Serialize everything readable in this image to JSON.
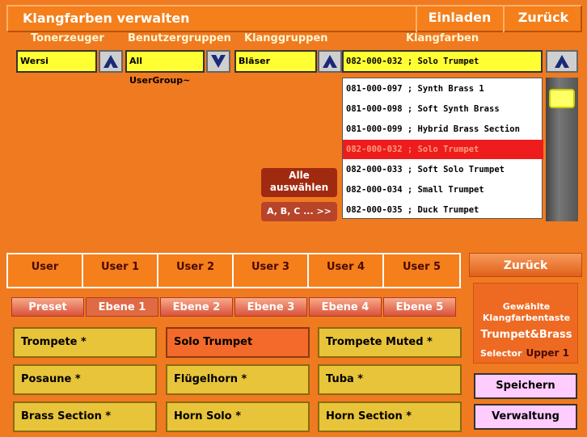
{
  "header": {
    "title": "Klangfarben verwalten",
    "load_label": "Einladen",
    "back_label": "Zurück"
  },
  "columns": {
    "tone_generator": "Tonerzeuger",
    "user_groups": "Benutzergruppen",
    "sound_groups": "Klanggruppen",
    "sounds": "Klangfarben"
  },
  "selectors": {
    "tone_generator": "Wersi",
    "user_group": "All UserGroup~",
    "sound_group": "Bläser",
    "sound": "082-000-032 ; Solo Trumpet"
  },
  "sound_list": [
    "081-000-097 ; Synth Brass 1",
    "081-000-098 ; Soft Synth Brass",
    "081-000-099 ; Hybrid Brass Section",
    "082-000-032 ; Solo Trumpet",
    "082-000-033 ; Soft Solo Trumpet",
    "082-000-034 ; Small Trumpet",
    "082-000-035 ; Duck Trumpet"
  ],
  "selected_index": 3,
  "select_all_label": "Alle auswählen",
  "alpha_label": "A, B, C ... >>",
  "users": [
    "User",
    "User 1",
    "User 2",
    "User 3",
    "User 4",
    "User 5"
  ],
  "levels": [
    "Preset",
    "Ebene 1",
    "Ebene 2",
    "Ebene 3",
    "Ebene 4",
    "Ebene 5"
  ],
  "active_level": 1,
  "sound_buttons": [
    "Trompete *",
    "Solo Trumpet",
    "Trompete Muted *",
    "Posaune *",
    "Flügelhorn *",
    "Tuba *",
    "Brass Section *",
    "Horn Solo *",
    "Horn Section *"
  ],
  "active_sound_button": 1,
  "right_panel": {
    "back_label": "Zurück",
    "info_title": "Gewählte Klangfarbentaste",
    "info_name": "Trumpet&Brass",
    "selector_label": "Selector",
    "selector_value": "Upper 1",
    "save_label": "Speichern",
    "admin_label": "Verwaltung"
  },
  "icons": {
    "up": "arrow-up-icon",
    "down": "arrow-down-icon"
  },
  "colors": {
    "background": "#f07a20",
    "selector": "#ffff33",
    "selected_row": "#ee1c1c",
    "sound_button": "#e8c43a",
    "pink_button": "#ffccff"
  }
}
